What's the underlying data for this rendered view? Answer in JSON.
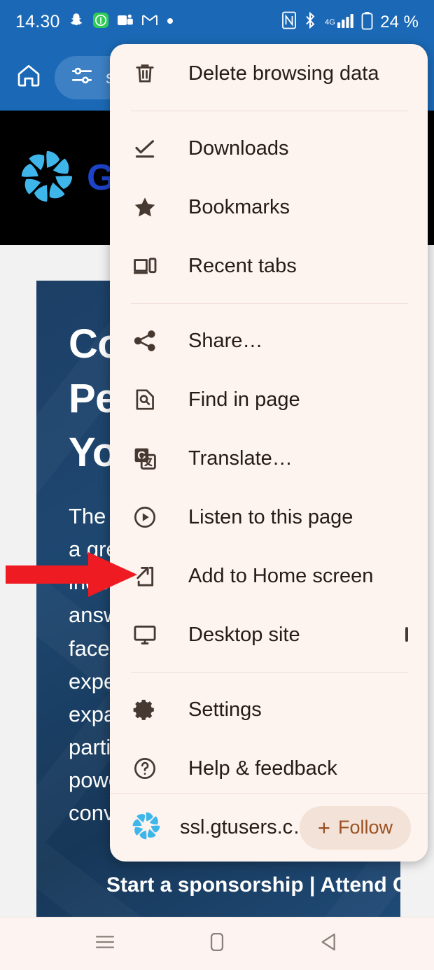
{
  "status_bar": {
    "time": "14.30",
    "battery_percent": "24 %",
    "signal_label": "4G",
    "left_icons": [
      "snapchat-icon",
      "green-shield-icon",
      "microsoft-teams-icon",
      "gmail-icon",
      "notification-dot-icon"
    ],
    "right_icons": [
      "nfc-icon",
      "bluetooth-icon",
      "signal-bars-icon",
      "battery-icon"
    ]
  },
  "toolbar": {
    "home_icon": "home-icon",
    "tune_icon": "tune-icon",
    "url_text": "ss"
  },
  "page": {
    "site_logo_icon": "gtu-pinwheel-logo",
    "site_wordmark": "GTU",
    "hero_title": "Connect with Peers and Build Your Network",
    "hero_body": "The Gartner user community is a great place to get independent, unbiased answers to the questions you face every day from experienced peers. Join us to expand your network and participate in unique and powerful technology conversations.",
    "hero_links": "Start a sponsorship  |\nAttend Conferences"
  },
  "menu": {
    "items": [
      {
        "label": "Delete browsing data",
        "icon": "trash-icon",
        "divider_after": true
      },
      {
        "label": "Downloads",
        "icon": "download-check-icon",
        "divider_after": false
      },
      {
        "label": "Bookmarks",
        "icon": "star-icon",
        "divider_after": false
      },
      {
        "label": "Recent tabs",
        "icon": "recent-tabs-icon",
        "divider_after": true
      },
      {
        "label": "Share…",
        "icon": "share-icon",
        "divider_after": false
      },
      {
        "label": "Find in page",
        "icon": "find-in-page-icon",
        "divider_after": false
      },
      {
        "label": "Translate…",
        "icon": "google-translate-icon",
        "divider_after": false
      },
      {
        "label": "Listen to this page",
        "icon": "play-circle-icon",
        "divider_after": false
      },
      {
        "label": "Add to Home screen",
        "icon": "add-to-home-screen-icon",
        "divider_after": false
      },
      {
        "label": "Desktop site",
        "icon": "desktop-monitor-icon",
        "divider_after": true,
        "checkbox": "unchecked"
      },
      {
        "label": "Settings",
        "icon": "gear-icon",
        "divider_after": false
      },
      {
        "label": "Help & feedback",
        "icon": "question-circle-icon",
        "divider_after": false
      }
    ],
    "footer": {
      "site_icon": "gtu-pinwheel-favicon",
      "site_name": "ssl.gtusers.c…",
      "follow_plus": "+",
      "follow_label": "Follow"
    }
  },
  "annotation": {
    "arrow_color": "#ee1b22",
    "points_at": "Add to Home screen"
  },
  "nav_bar": {
    "recents_icon": "recent-apps-icon",
    "home_icon": "home-square-icon",
    "back_icon": "back-triangle-icon"
  },
  "colors": {
    "toolbar_blue": "#1b69b6",
    "url_pill_blue": "#3d80c4",
    "menu_bg": "#fdf3ef",
    "menu_text": "#231c18",
    "menu_icon": "#463931",
    "follow_bg": "#f2e2d7",
    "follow_text": "#9a5122",
    "hero_blue": "#1d3f66",
    "brand_blue": "#1e43c8",
    "logo_cyan": "#3fb6ea",
    "arrow_red": "#ee1b22"
  }
}
